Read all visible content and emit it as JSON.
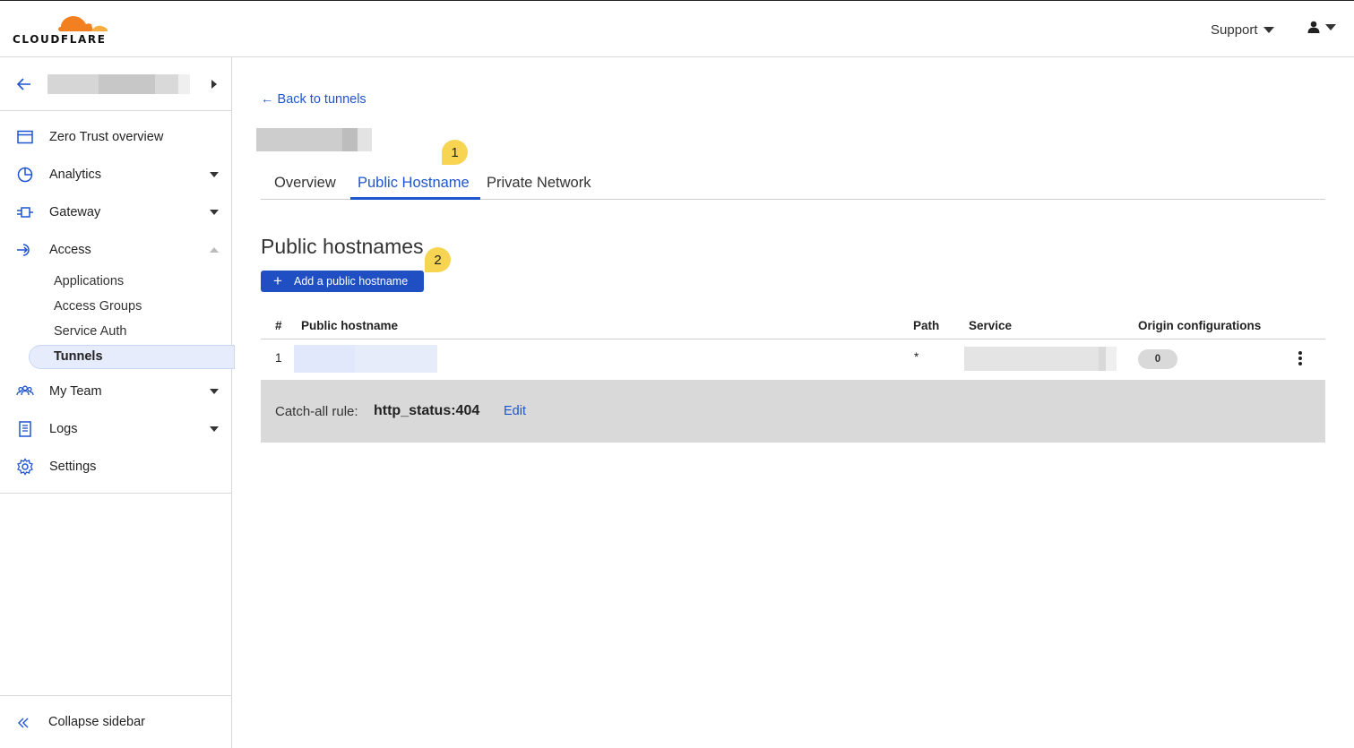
{
  "header": {
    "logo_text": "CLOUDFLARE",
    "support_label": "Support",
    "brand_color": "#f38020"
  },
  "sidebar": {
    "items": [
      {
        "label": "Zero Trust overview",
        "icon": "browser-window-icon"
      },
      {
        "label": "Analytics",
        "icon": "pie-chart-icon"
      },
      {
        "label": "Gateway",
        "icon": "gateway-icon"
      },
      {
        "label": "Access",
        "icon": "access-icon"
      },
      {
        "label": "My Team",
        "icon": "team-icon"
      },
      {
        "label": "Logs",
        "icon": "document-icon"
      },
      {
        "label": "Settings",
        "icon": "gear-icon"
      }
    ],
    "access_subitems": [
      "Applications",
      "Access Groups",
      "Service Auth",
      "Tunnels"
    ],
    "collapse_label": "Collapse sidebar"
  },
  "main": {
    "back_link": "← Back to tunnels",
    "tabs": [
      "Overview",
      "Public Hostname",
      "Private Network"
    ],
    "active_tab": "Public Hostname",
    "section_title": "Public hostnames",
    "add_button_label": "Add a public hostname",
    "table": {
      "columns": [
        "#",
        "Public hostname",
        "Path",
        "Service",
        "Origin configurations"
      ],
      "rows": [
        {
          "index": "1",
          "path": "*",
          "origin_configurations": "0"
        }
      ]
    },
    "catchall": {
      "label": "Catch-all rule:",
      "value": "http_status:404",
      "edit_label": "Edit"
    },
    "callouts": [
      "1",
      "2"
    ],
    "accent_color": "#1f55d1",
    "callout_color": "#f7d553"
  }
}
